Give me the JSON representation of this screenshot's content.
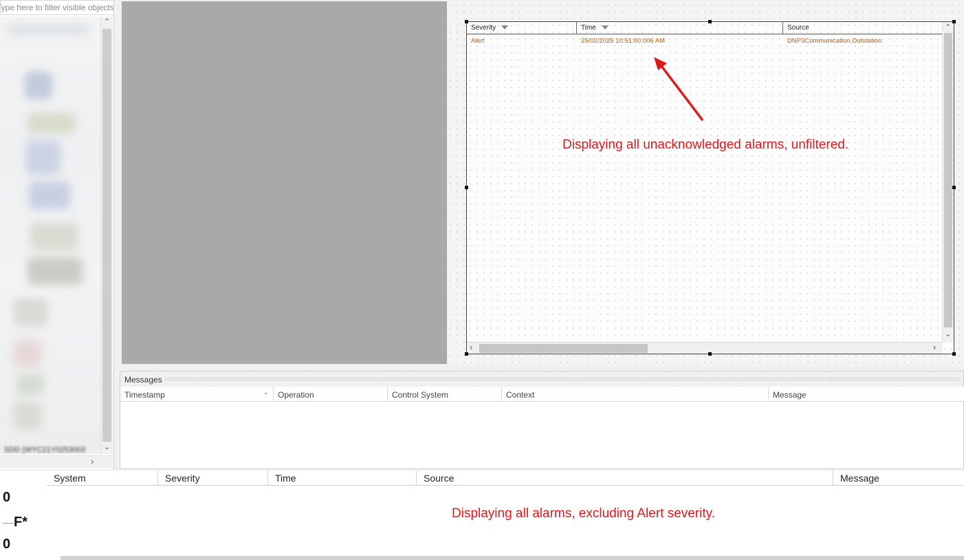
{
  "object_tree": {
    "filter_placeholder": "Type here to filter visible objects",
    "last_item_label": "SDD (WYC21Y0253003"
  },
  "alarm_widget": {
    "columns": [
      "Severity",
      "Time",
      "Source"
    ],
    "rows": [
      {
        "severity": "Alert",
        "time": "25/02/2025 10:51:00.006 AM",
        "source": "DNP3Communication.Outstation"
      }
    ],
    "row_color": "#b45a14"
  },
  "annotations": {
    "top": "Displaying all unacknowledged alarms, unfiltered.",
    "bottom": "Displaying all alarms, excluding Alert severity.",
    "color": "#e3161b"
  },
  "messages": {
    "title": "Messages",
    "columns": [
      "Timestamp",
      "Operation",
      "Control System",
      "Context",
      "Message"
    ]
  },
  "bottom_grid": {
    "columns": [
      "System",
      "Severity",
      "Time",
      "Source",
      "Message"
    ]
  },
  "left_values": {
    "top": "0",
    "middle": "F*",
    "bottom": "0"
  }
}
